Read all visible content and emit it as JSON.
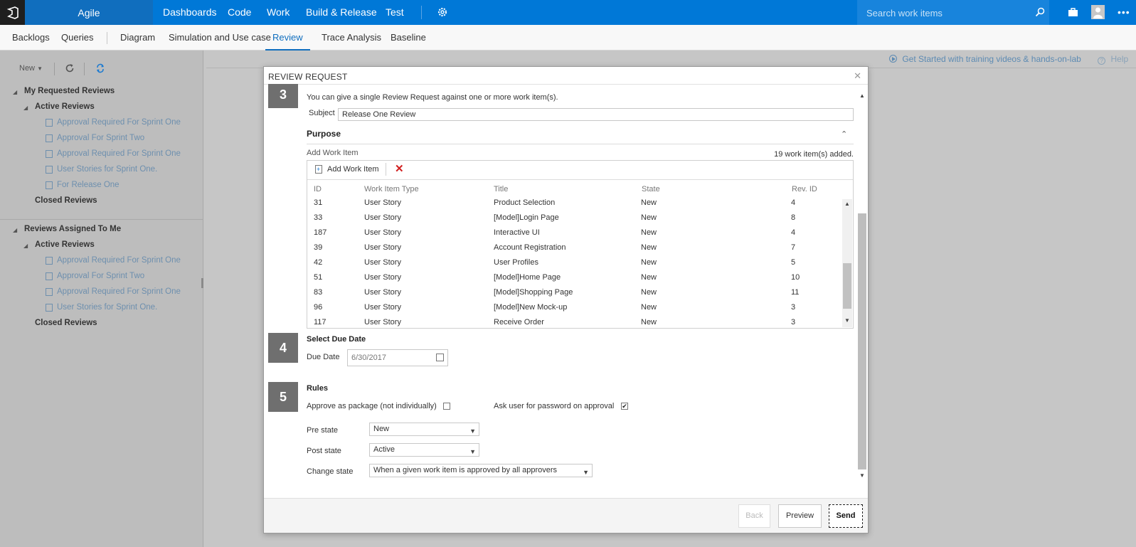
{
  "topbar": {
    "project": "Agile",
    "nav": [
      "Dashboards",
      "Code",
      "Work",
      "Build & Release",
      "Test"
    ],
    "search_placeholder": "Search work items"
  },
  "subnav": {
    "tabs": [
      "Backlogs",
      "Queries",
      "Diagram",
      "Simulation and Use case",
      "Review",
      "Trace Analysis",
      "Baseline"
    ],
    "active": "Review"
  },
  "left": {
    "new_label": "New",
    "my_requested": {
      "title": "My Requested Reviews",
      "active_title": "Active Reviews",
      "items": [
        "Approval Required For Sprint One",
        "Approval For Sprint Two",
        "Approval Required For Sprint One",
        "User Stories for Sprint One.",
        "For Release One"
      ],
      "closed_title": "Closed Reviews"
    },
    "assigned": {
      "title": "Reviews Assigned To Me",
      "active_title": "Active Reviews",
      "items": [
        "Approval Required For Sprint One",
        "Approval For Sprint Two",
        "Approval Required For Sprint One",
        "User Stories for Sprint One."
      ],
      "closed_title": "Closed Reviews"
    }
  },
  "infobar": {
    "get_started": "Get Started with training videos & hands-on-lab",
    "help": "Help"
  },
  "dialog": {
    "title": "REVIEW REQUEST",
    "step3": {
      "number": "3",
      "intro": "You can give a single Review Request against one or more work item(s).",
      "subject_label": "Subject",
      "subject_value": "Release One Review",
      "purpose_label": "Purpose",
      "add_label": "Add Work Item",
      "added_count": "19 work item(s) added.",
      "add_button": "Add Work Item",
      "columns": [
        "ID",
        "Work Item Type",
        "Title",
        "State",
        "Rev. ID"
      ],
      "rows": [
        [
          "31",
          "User Story",
          "Product Selection",
          "New",
          "4"
        ],
        [
          "33",
          "User Story",
          "[Model]Login Page",
          "New",
          "8"
        ],
        [
          "187",
          "User Story",
          "Interactive UI",
          "New",
          "4"
        ],
        [
          "39",
          "User Story",
          "Account Registration",
          "New",
          "7"
        ],
        [
          "42",
          "User Story",
          "User Profiles",
          "New",
          "5"
        ],
        [
          "51",
          "User Story",
          "[Model]Home Page",
          "New",
          "10"
        ],
        [
          "83",
          "User Story",
          "[Model]Shopping Page",
          "New",
          "11"
        ],
        [
          "96",
          "User Story",
          "[Model]New Mock-up",
          "New",
          "3"
        ],
        [
          "117",
          "User Story",
          "Receive Order",
          "New",
          "3"
        ]
      ]
    },
    "step4": {
      "number": "4",
      "title": "Select Due Date",
      "due_label": "Due Date",
      "due_value": "6/30/2017"
    },
    "step5": {
      "number": "5",
      "title": "Rules",
      "approve_package_label": "Approve as package (not individually)",
      "approve_package_checked": false,
      "ask_password_label": "Ask user for password on approval",
      "ask_password_checked": true,
      "pre_state_label": "Pre state",
      "pre_state_value": "New",
      "post_state_label": "Post state",
      "post_state_value": "Active",
      "change_state_label": "Change state",
      "change_state_value": "When a given work item is approved by all approvers"
    },
    "buttons": {
      "back": "Back",
      "preview": "Preview",
      "send": "Send"
    }
  }
}
